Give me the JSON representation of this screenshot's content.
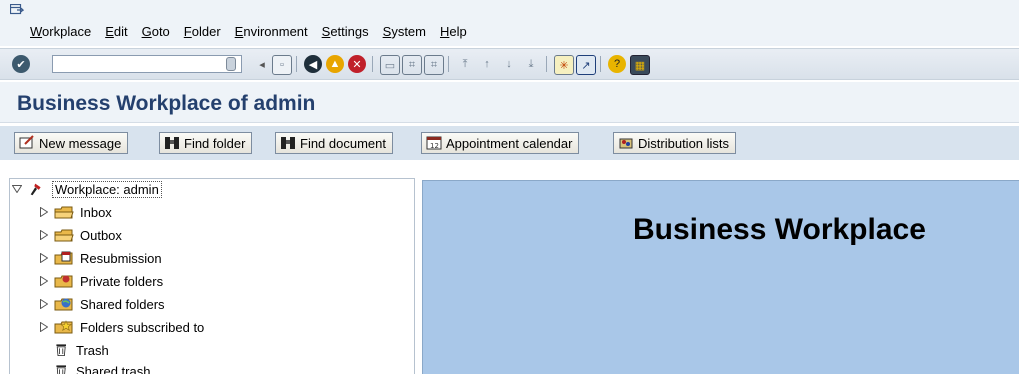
{
  "menubar": {
    "items": [
      "Workplace",
      "Edit",
      "Goto",
      "Folder",
      "Environment",
      "Settings",
      "System",
      "Help"
    ]
  },
  "toolbar": {
    "command_field_value": ""
  },
  "page": {
    "title": "Business Workplace of admin"
  },
  "app_toolbar": {
    "buttons": [
      "New message",
      "Find folder",
      "Find document",
      "Appointment calendar",
      "Distribution lists"
    ]
  },
  "tree": {
    "root": "Workplace: admin",
    "items": [
      "Inbox",
      "Outbox",
      "Resubmission",
      "Private folders",
      "Shared folders",
      "Folders subscribed to",
      "Trash",
      "Shared trash"
    ]
  },
  "right_pane": {
    "title": "Business Workplace"
  },
  "colors": {
    "title_blue": "#24406e",
    "right_pane_bg": "#a9c7e8",
    "toolbar_bg": "#d8e3ee"
  }
}
